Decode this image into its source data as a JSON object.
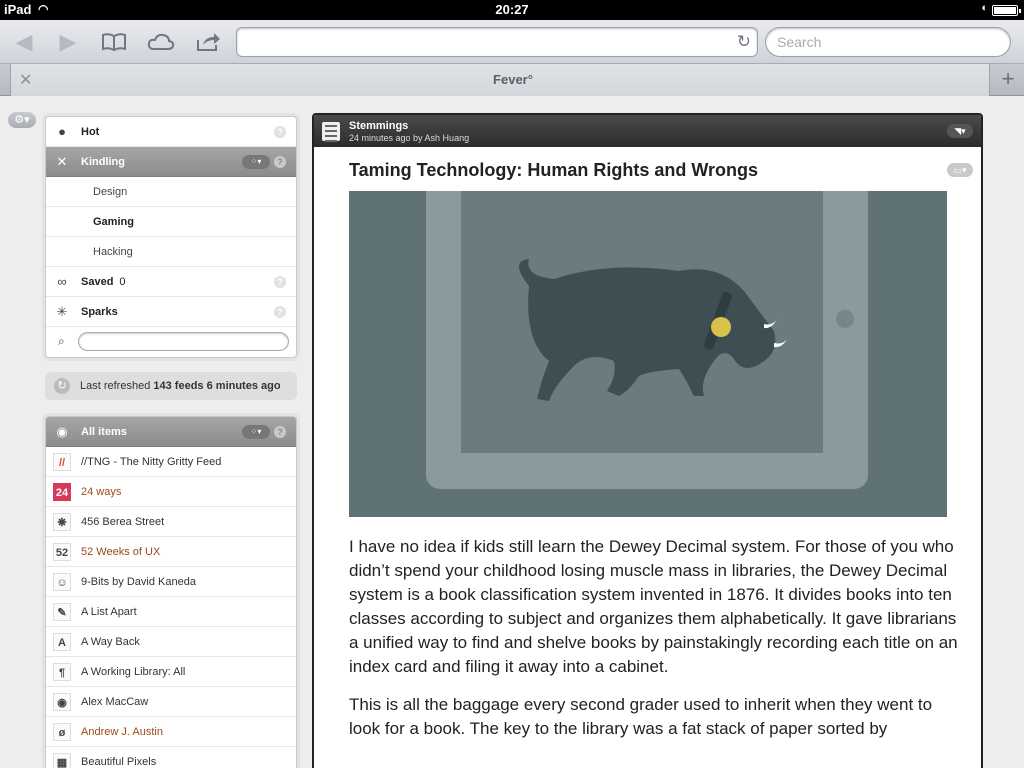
{
  "status_bar": {
    "device": "iPad",
    "time": "20:27"
  },
  "browser": {
    "tab_title": "Fever°",
    "search_placeholder": "Search",
    "url": ""
  },
  "sidebar": {
    "groups": [
      {
        "label": "Hot",
        "icon": "flame-icon"
      },
      {
        "label": "Kindling",
        "icon": "kindling-icon",
        "active": true
      },
      {
        "label": "Design",
        "sub": true
      },
      {
        "label": "Gaming",
        "sub": true,
        "bold": true
      },
      {
        "label": "Hacking",
        "sub": true
      },
      {
        "label": "Saved",
        "icon": "infinity-icon",
        "count": "0"
      },
      {
        "label": "Sparks",
        "icon": "sparks-icon"
      }
    ],
    "refresh": {
      "prefix": "Last refreshed",
      "feeds": "143 feeds",
      "ago": "6 minutes ago"
    },
    "all_items_label": "All items",
    "feeds": [
      {
        "label": "//TNG - The Nitty Gritty Feed",
        "icon": "//",
        "unread": false
      },
      {
        "label": "24 ways",
        "icon": "24",
        "unread": true
      },
      {
        "label": "456 Berea Street",
        "icon": "❋",
        "unread": false
      },
      {
        "label": "52 Weeks of UX",
        "icon": "52",
        "unread": true
      },
      {
        "label": "9-Bits by David Kaneda",
        "icon": "☺",
        "unread": false
      },
      {
        "label": "A List Apart",
        "icon": "✎",
        "unread": false
      },
      {
        "label": "A Way Back",
        "icon": "A",
        "unread": false
      },
      {
        "label": "A Working Library: All",
        "icon": "¶",
        "unread": false
      },
      {
        "label": "Alex MacCaw",
        "icon": "◉",
        "unread": false
      },
      {
        "label": "Andrew J. Austin",
        "icon": "ø",
        "unread": true
      },
      {
        "label": "Beautiful Pixels",
        "icon": "▦",
        "unread": false
      }
    ]
  },
  "article": {
    "feed_name": "Stemmings",
    "meta": "24 minutes ago by Ash Huang",
    "title": "Taming Technology: Human Rights and Wrongs",
    "paragraphs": [
      "I have no idea if kids still learn the Dewey Decimal system. For those of you who didn’t spend your childhood losing muscle mass in libraries, the Dewey Decimal system is a book classification system invented in 1876. It divides books into ten classes according to subject and organizes them alphabetically. It gave librarians a unified way to find and shelve books by painstakingly recording each title on an index card and filing it away into a cabinet.",
      "This is all the baggage every second grader used to inherit when they went to look for a book. The key to the library was a fat stack of paper sorted by"
    ],
    "colors": {
      "illustration_bg": "#5f7377",
      "tablet": "#8a9a9e",
      "screen": "#6a7c80",
      "bull": "#3e4f54",
      "tag": "#d8c24a"
    }
  }
}
